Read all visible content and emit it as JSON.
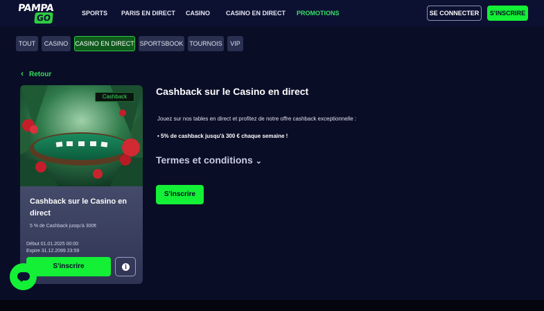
{
  "header": {
    "logo_top": "PAMPA",
    "logo_bottom": "GO",
    "nav": [
      "SPORTS",
      "PARIS EN DIRECT",
      "CASINO",
      "CASINO EN DIRECT",
      "PROMOTIONS"
    ],
    "login": "SE CONNECTER",
    "signup": "S'INSCRIRE"
  },
  "tabs": [
    "TOUT",
    "CASINO",
    "CASINO EN DIRECT",
    "SPORTSBOOK",
    "TOURNOIS",
    "VIP"
  ],
  "active_tab": "CASINO EN DIRECT",
  "back_label": "Retour",
  "card": {
    "badge": "Cashback",
    "title": "Cashback sur le Casino en direct",
    "subtitle": "5 % de Cashback jusqu'à 300€",
    "start": "Début 01.01.2025 00:00",
    "expire": "Expire 31.12.2099 23:59",
    "button": "S'inscrire"
  },
  "main": {
    "title": "Cashback sur le Casino en direct",
    "description": "Jouez sur nos tables en direct et profitez de notre offre cashback exceptionnelle :",
    "bullet": "• 5% de cashback jusqu'à 300 € chaque semaine !",
    "terms": "Termes et conditions",
    "button": "S'inscrire"
  },
  "icons": {
    "back": "chevron-left-icon",
    "terms": "chevron-down-icon",
    "info": "info-icon",
    "chat": "chat-icon"
  },
  "colors": {
    "accent": "#13f036",
    "background": "#0a0d26",
    "card": "#1f2441"
  }
}
